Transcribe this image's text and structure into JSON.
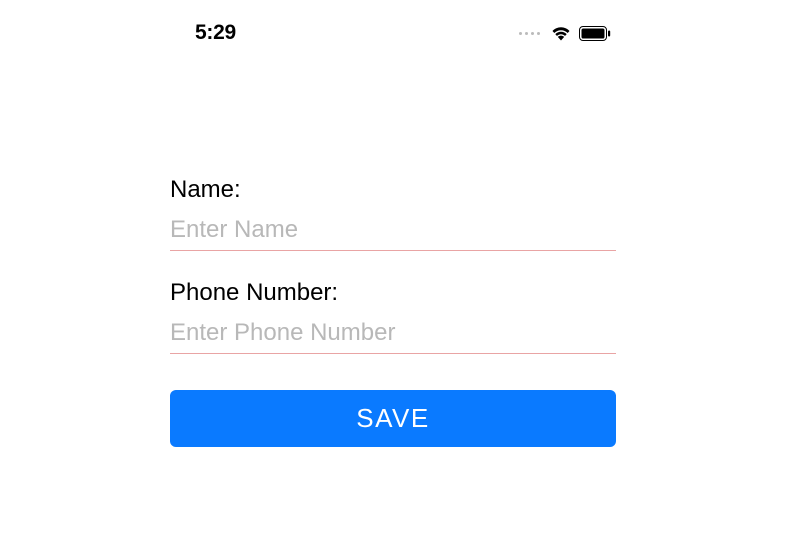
{
  "status_bar": {
    "time": "5:29"
  },
  "form": {
    "name": {
      "label": "Name:",
      "placeholder": "Enter Name",
      "value": ""
    },
    "phone": {
      "label": "Phone Number:",
      "placeholder": "Enter Phone Number",
      "value": ""
    },
    "save_button_label": "SAVE"
  }
}
